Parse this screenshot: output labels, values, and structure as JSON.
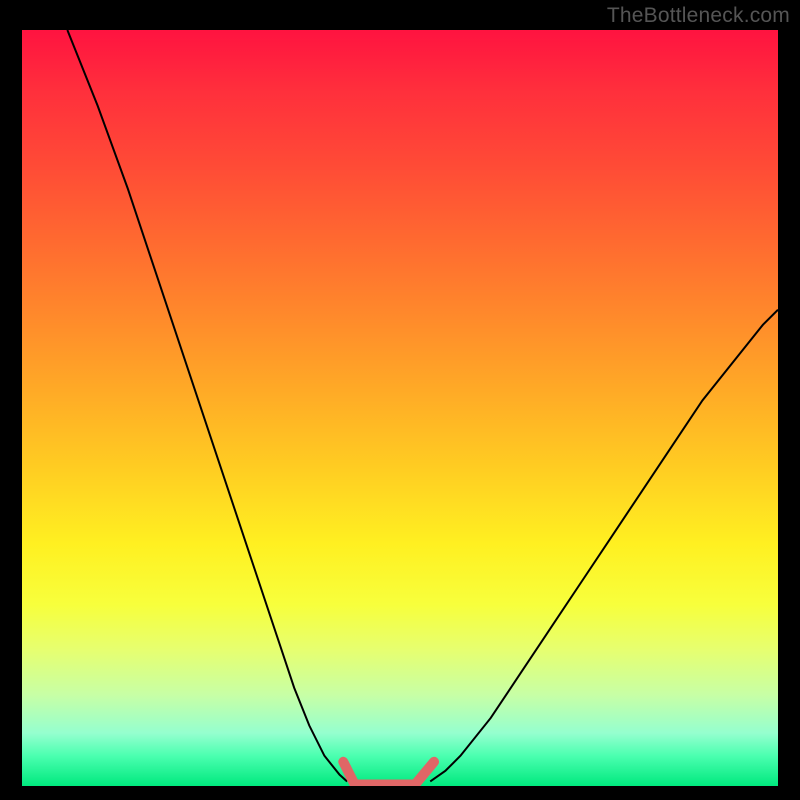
{
  "watermark": "TheBottleneck.com",
  "chart_data": {
    "type": "line",
    "title": "",
    "xlabel": "",
    "ylabel": "",
    "xlim": [
      0,
      100
    ],
    "ylim": [
      0,
      100
    ],
    "grid": false,
    "legend": false,
    "gradient_stops": [
      {
        "pos": 0,
        "color": "#ff1340"
      },
      {
        "pos": 8,
        "color": "#ff2f3c"
      },
      {
        "pos": 18,
        "color": "#ff4b36"
      },
      {
        "pos": 28,
        "color": "#ff6a30"
      },
      {
        "pos": 38,
        "color": "#ff8a2b"
      },
      {
        "pos": 48,
        "color": "#ffab26"
      },
      {
        "pos": 58,
        "color": "#ffcd22"
      },
      {
        "pos": 68,
        "color": "#fff021"
      },
      {
        "pos": 76,
        "color": "#f7ff3c"
      },
      {
        "pos": 82,
        "color": "#e6ff70"
      },
      {
        "pos": 88,
        "color": "#c7ffa6"
      },
      {
        "pos": 93,
        "color": "#95ffcf"
      },
      {
        "pos": 96,
        "color": "#4bffb0"
      },
      {
        "pos": 100,
        "color": "#00e97e"
      }
    ],
    "series": [
      {
        "name": "left-curve",
        "stroke": "#000000",
        "stroke_width": 2,
        "x": [
          6,
          10,
          14,
          18,
          22,
          26,
          30,
          34,
          36,
          38,
          40,
          42,
          43
        ],
        "y": [
          100,
          90,
          79,
          67,
          55,
          43,
          31,
          19,
          13,
          8,
          4,
          1.5,
          0.6
        ]
      },
      {
        "name": "right-curve",
        "stroke": "#000000",
        "stroke_width": 2,
        "x": [
          54,
          56,
          58,
          62,
          66,
          70,
          74,
          78,
          82,
          86,
          90,
          94,
          98,
          100
        ],
        "y": [
          0.6,
          2,
          4,
          9,
          15,
          21,
          27,
          33,
          39,
          45,
          51,
          56,
          61,
          63
        ]
      },
      {
        "name": "valley-marker",
        "stroke": "#e06666",
        "stroke_width": 10,
        "linecap": "round",
        "x": [
          42.5,
          44,
          46,
          48,
          50,
          52,
          54.5
        ],
        "y": [
          3.2,
          0.2,
          0.2,
          0.2,
          0.2,
          0.2,
          3.2
        ]
      }
    ]
  }
}
